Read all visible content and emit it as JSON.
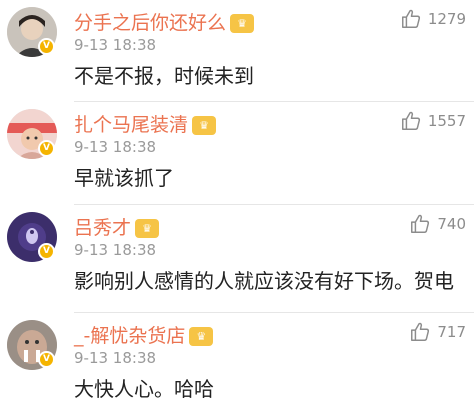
{
  "comments": [
    {
      "user": "分手之后你还好么",
      "vip_badge": "vip-crown-icon",
      "time": "9-13 18:38",
      "text": "不是不报，时候未到",
      "likes": "1279"
    },
    {
      "user": "扎个马尾装清",
      "vip_badge": "vip-crown-icon",
      "time": "9-13 18:38",
      "text": "早就该抓了",
      "likes": "1557"
    },
    {
      "user": "吕秀才",
      "vip_badge": "vip-crown-icon",
      "time": "9-13 18:38",
      "text": "影响别人感情的人就应该没有好下场。贺电",
      "likes": "740"
    },
    {
      "user": "_-解忧杂货店",
      "vip_badge": "vip-crown-icon",
      "time": "9-13 18:38",
      "text": "大快人心。哈哈",
      "likes": "717"
    }
  ],
  "colors": {
    "username": "#eb7350",
    "time": "#9a9a9a",
    "badge": "#f5b400"
  }
}
